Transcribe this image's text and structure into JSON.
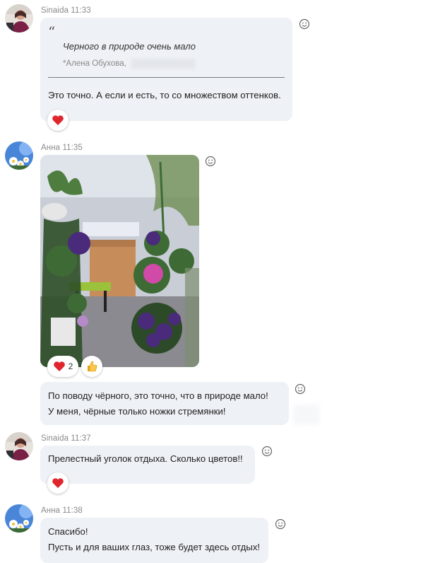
{
  "messages": [
    {
      "sender": "Sinaida",
      "time": "11:33",
      "quote": {
        "text": "Черного в природе очень мало",
        "author": "*Алена Обухова,"
      },
      "text": "Это точно. А если и есть, то со множеством оттенков.",
      "reactions": [
        {
          "icon": "heart-icon"
        }
      ]
    },
    {
      "sender": "Анна",
      "time": "11:35",
      "image": {
        "description": "photo-balcony-with-flowers",
        "colors": {
          "wall": "#c9cdd6",
          "floor": "#8a8a90",
          "leaves": "#3e6b35",
          "violet": "#4a2a7a",
          "pink": "#d04aa8",
          "cabinet": "#c68c5a"
        }
      },
      "reactions": [
        {
          "icon": "heart-icon",
          "count": "2"
        },
        {
          "icon": "thumbs-up-icon"
        }
      ]
    },
    {
      "lines": [
        "По поводу чёрного, это точно, что в природе мало!",
        "У меня, чёрные только ножки стремянки!"
      ]
    },
    {
      "sender": "Sinaida",
      "time": "11:37",
      "text": "Прелестный уголок отдыха. Сколько цветов!!",
      "reactions": [
        {
          "icon": "heart-icon"
        }
      ]
    },
    {
      "sender": "Анна",
      "time": "11:38",
      "lines": [
        "Спасибо!",
        "Пусть и для ваших глаз, тоже будет здесь отдых!"
      ]
    }
  ],
  "colors": {
    "bubble": "#eef1f5",
    "heart": "#e0262d",
    "meta": "#8a8a8a"
  }
}
